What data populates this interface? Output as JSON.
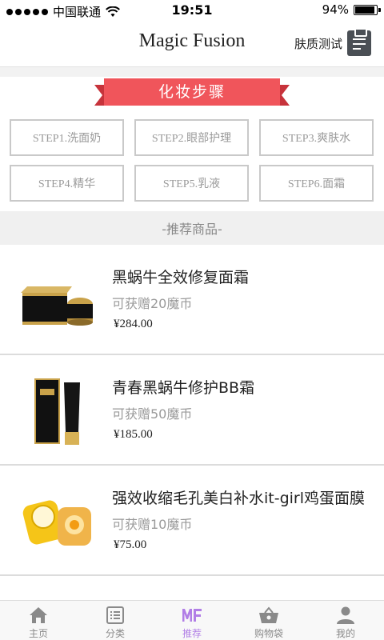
{
  "status_bar": {
    "carrier": "中国联通",
    "time": "19:51",
    "battery": "94%",
    "battery_level": 0.94
  },
  "header": {
    "title": "Magic Fusion",
    "skin_test_label": "肤质测试",
    "skin_test_icon": "clipboard-icon"
  },
  "steps": {
    "banner": "化妆步骤",
    "banner_color": "#f0555b",
    "items": [
      {
        "label": "STEP1.洗面奶"
      },
      {
        "label": "STEP2.眼部护理"
      },
      {
        "label": "STEP3.爽肤水"
      },
      {
        "label": "STEP4.精华"
      },
      {
        "label": "STEP5.乳液"
      },
      {
        "label": "STEP6.面霜"
      }
    ]
  },
  "recommend": {
    "header": "-推荐商品-",
    "products": [
      {
        "name": "黑蜗牛全效修复面霜",
        "reward": "可获赠20魔币",
        "price": "¥284.00"
      },
      {
        "name": "青春黑蜗牛修护BB霜",
        "reward": "可获赠50魔币",
        "price": "¥185.00"
      },
      {
        "name": "强效收缩毛孔美白补水it-girl鸡蛋面膜",
        "reward": "可获赠10魔币",
        "price": "¥75.00"
      }
    ]
  },
  "tab_bar": {
    "active_color": "#b17ee6",
    "tabs": [
      {
        "label": "主页",
        "icon": "home-icon"
      },
      {
        "label": "分类",
        "icon": "list-icon"
      },
      {
        "label": "推荐",
        "icon": "mf-logo-icon",
        "active": true
      },
      {
        "label": "购物袋",
        "icon": "basket-icon"
      },
      {
        "label": "我的",
        "icon": "user-icon"
      }
    ]
  }
}
